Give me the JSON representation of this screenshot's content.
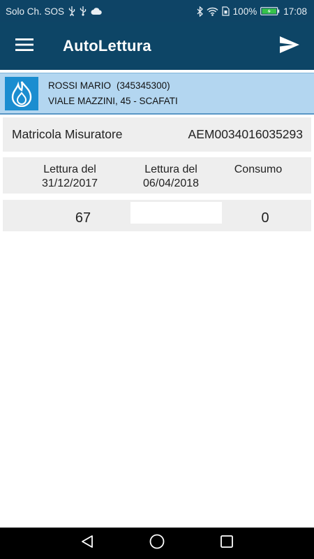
{
  "status_bar": {
    "carrier": "Solo Ch. SOS",
    "battery": "100%",
    "time": "17:08",
    "icons_left": [
      "usb-icon",
      "usb-icon",
      "cloud-icon"
    ],
    "icons_right": [
      "bluetooth-icon",
      "wifi-icon",
      "sim-icon",
      "battery-charging-icon"
    ]
  },
  "app_bar": {
    "title": "AutoLettura",
    "menu_icon": "menu-icon",
    "send_icon": "send-icon"
  },
  "customer": {
    "name": "ROSSI MARIO",
    "code": "(345345300)",
    "address": "VIALE MAZZINI, 45 - SCAFATI",
    "logo_icon": "gas-flame-icon",
    "logo_color": "#1b8dd0"
  },
  "meter": {
    "label": "Matricola Misuratore",
    "value": "AEM0034016035293"
  },
  "readings": {
    "headers": [
      {
        "line1": "Lettura del",
        "line2": "31/12/2017"
      },
      {
        "line1": "Lettura del",
        "line2": "06/04/2018"
      },
      {
        "line1": "Consumo",
        "line2": ""
      }
    ],
    "previous_value": "67",
    "current_value": "",
    "consumption": "0"
  },
  "nav_bar": {
    "buttons": [
      "back-icon",
      "home-icon",
      "recents-icon"
    ]
  },
  "colors": {
    "primary": "#0d4566",
    "banner": "#b3d6f0",
    "card": "#eeeeee"
  }
}
